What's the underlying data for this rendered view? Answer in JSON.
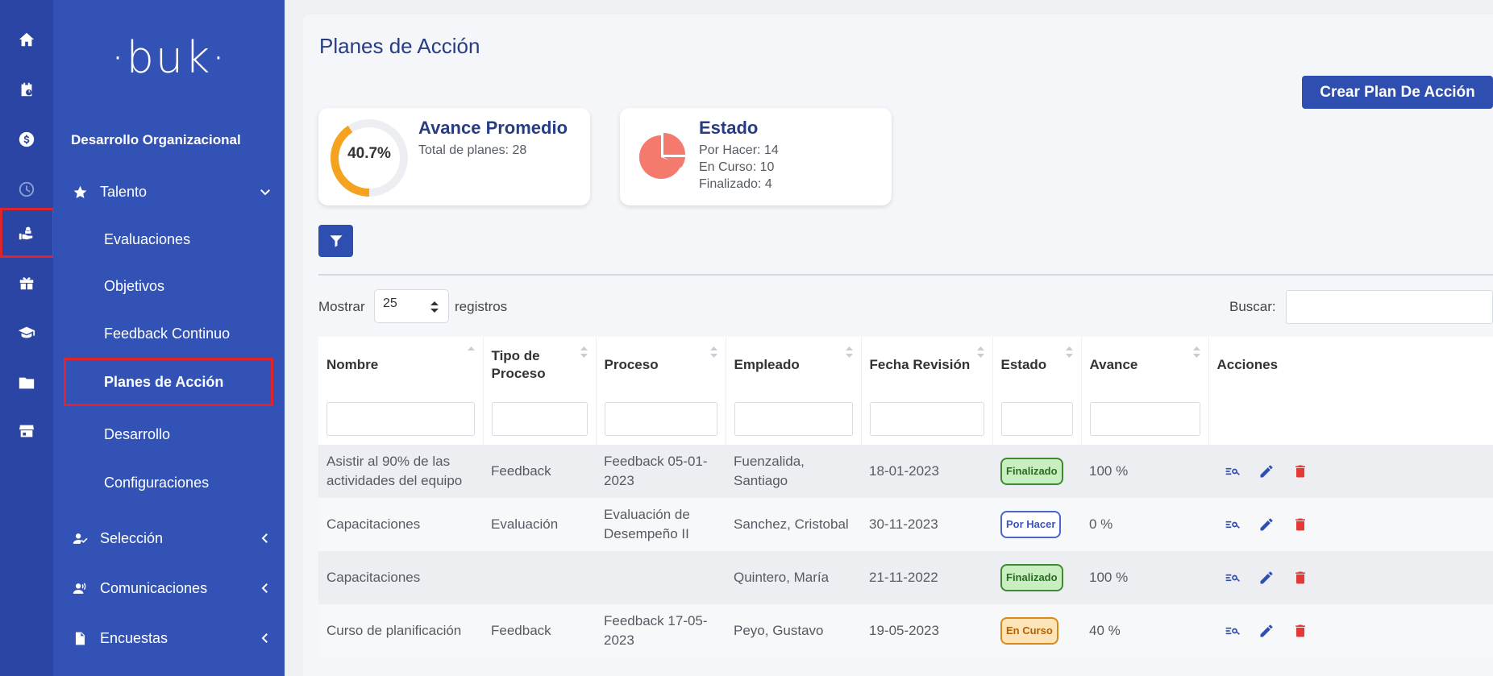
{
  "sidebar": {
    "logo": "·buk·",
    "section_title": "Desarrollo Organizacional",
    "groups": {
      "talento": "Talento",
      "seleccion": "Selección",
      "comunicaciones": "Comunicaciones",
      "encuestas": "Encuestas"
    },
    "talento_items": [
      "Evaluaciones",
      "Objetivos",
      "Feedback Continuo",
      "Planes de Acción",
      "Desarrollo",
      "Configuraciones"
    ],
    "active_item": "Planes de Acción"
  },
  "rail_icons": [
    "home-icon",
    "clipboard-clock-icon",
    "dollar-icon",
    "clock-icon",
    "hand-user-icon",
    "gift-icon",
    "graduation-cap-icon",
    "folder-icon",
    "store-icon"
  ],
  "page": {
    "title": "Planes de Acción",
    "create_button": "Crear Plan De Acción"
  },
  "avance_card": {
    "title": "Avance Promedio",
    "percent_label": "40.7%",
    "percent_value": 40.7,
    "total": "Total de planes: 28"
  },
  "estado_card": {
    "title": "Estado",
    "por_hacer": "Por Hacer: 14",
    "en_curso": "En Curso: 10",
    "finalizado": "Finalizado: 4",
    "pie_color": "#f47a6e"
  },
  "table_controls": {
    "show_label": "Mostrar",
    "page_size": "25",
    "records_label": "registros",
    "search_label": "Buscar:"
  },
  "table": {
    "headers": {
      "nombre": "Nombre",
      "tipo": "Tipo de Proceso",
      "proceso": "Proceso",
      "empleado": "Empleado",
      "fecha": "Fecha Revisión",
      "estado": "Estado",
      "avance": "Avance",
      "acciones": "Acciones"
    },
    "rows": [
      {
        "nombre": "Asistir al 90% de las actividades del equipo",
        "tipo": "Feedback",
        "proceso": "Feedback 05-01-2023",
        "empleado": "Fuenzalida, Santiago",
        "fecha": "18-01-2023",
        "estado": "Finalizado",
        "avance": "100 %"
      },
      {
        "nombre": "Capacitaciones",
        "tipo": "Evaluación",
        "proceso": "Evaluación de Desempeño II",
        "empleado": "Sanchez, Cristobal",
        "fecha": "30-11-2023",
        "estado": "Por Hacer",
        "avance": "0 %"
      },
      {
        "nombre": "Capacitaciones",
        "tipo": "",
        "proceso": "",
        "empleado": "Quintero, María",
        "fecha": "21-11-2022",
        "estado": "Finalizado",
        "avance": "100 %"
      },
      {
        "nombre": "Curso de planificación",
        "tipo": "Feedback",
        "proceso": "Feedback 17-05-2023",
        "empleado": "Peyo, Gustavo",
        "fecha": "19-05-2023",
        "estado": "En Curso",
        "avance": "40 %"
      }
    ]
  },
  "colors": {
    "rail": "#2a45a3",
    "sidebar": "#3252b5",
    "primary": "#2f4fb0",
    "title": "#283c82",
    "donut": "#f5a21f",
    "highlight": "#e0242e",
    "delete": "#e53935"
  }
}
